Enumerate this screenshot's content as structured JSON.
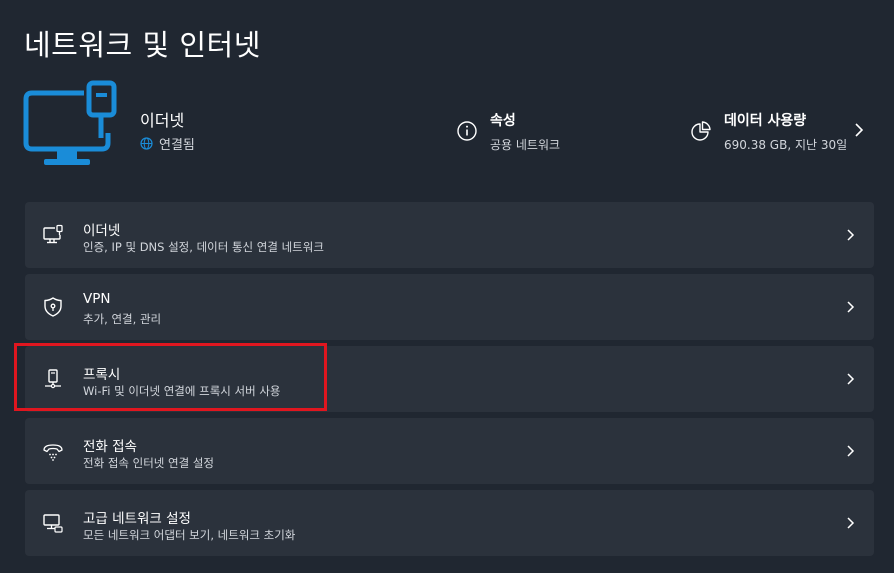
{
  "page": {
    "title": "네트워크 및 인터넷"
  },
  "hero": {
    "icon": "ethernet-monitor-icon",
    "name": "이더넷",
    "status": "연결됨",
    "properties": {
      "title": "속성",
      "subtitle": "공용 네트워크",
      "icon": "info-icon"
    },
    "data_usage": {
      "title": "데이터 사용량",
      "subtitle": "690.38 GB, 지난 30일",
      "icon": "pie-chart-icon"
    }
  },
  "cards": [
    {
      "title": "이더넷",
      "subtitle": "인증, IP 및 DNS 설정, 데이터 통신 연결 네트워크",
      "icon": "ethernet-icon"
    },
    {
      "title": "VPN",
      "subtitle": "추가, 연결, 관리",
      "icon": "shield-icon"
    },
    {
      "title": "프록시",
      "subtitle": "Wi-Fi 및 이더넷 연결에 프록시 서버 사용",
      "icon": "proxy-server-icon"
    },
    {
      "title": "전화 접속",
      "subtitle": "전화 접속 인터넷 연결 설정",
      "icon": "dialup-phone-icon"
    },
    {
      "title": "고급 네트워크 설정",
      "subtitle": "모든 네트워크 어댑터 보기, 네트워크 초기화",
      "icon": "network-pc-icon"
    }
  ],
  "colors": {
    "accent": "#1a8cd8",
    "background": "#202731",
    "card": "#2b323c",
    "highlight": "#e0161f"
  }
}
